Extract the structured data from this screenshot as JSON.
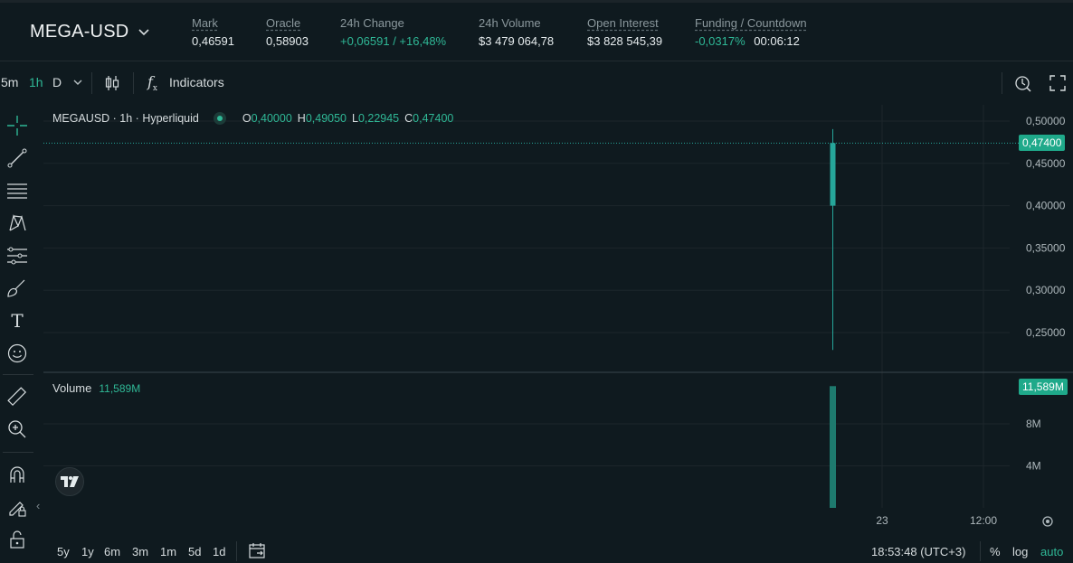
{
  "market": {
    "symbol": "MEGA-USD",
    "stats": [
      {
        "label": "Mark",
        "value": "0,46591"
      },
      {
        "label": "Oracle",
        "value": "0,58903"
      },
      {
        "label": "24h Change",
        "value": "+0,06591 / +16,48%"
      },
      {
        "label": "24h Volume",
        "value": "$3 479 064,78"
      },
      {
        "label": "Open Interest",
        "value": "$3 828 545,39"
      },
      {
        "label": "Funding / Countdown",
        "value_rate": "-0,0317%",
        "value_countdown": "00:06:12"
      }
    ]
  },
  "toolbar": {
    "intervals": [
      "5m",
      "1h",
      "D"
    ],
    "active_interval": "1h",
    "indicators_label": "Indicators"
  },
  "legend": {
    "title": "MEGAUSD · 1h · Hyperliquid",
    "open_key": "O",
    "open": "0,40000",
    "high_key": "H",
    "high": "0,49050",
    "low_key": "L",
    "low": "0,22945",
    "close_key": "C",
    "close": "0,47400"
  },
  "volume": {
    "label": "Volume",
    "value": "11,589M"
  },
  "price_tag": "0,47400",
  "volume_tag": "11,589M",
  "bottom": {
    "ranges": [
      "5y",
      "1y",
      "6m",
      "3m",
      "1m",
      "5d",
      "1d"
    ],
    "clock": "18:53:48 (UTC+3)",
    "percent": "%",
    "log": "log",
    "auto": "auto"
  },
  "colors": {
    "up": "#26a69a",
    "accent": "#2fb896",
    "background": "#0f1a1f",
    "grid": "#1c262b"
  },
  "chart_data": {
    "type": "candlestick",
    "price_axis": {
      "ticks": [
        "0,50000",
        "0,45000",
        "0,40000",
        "0,35000",
        "0,30000",
        "0,25000"
      ],
      "range": [
        0.2,
        0.5
      ]
    },
    "volume_axis": {
      "ticks": [
        "8M",
        "4M"
      ],
      "range": [
        0,
        12
      ]
    },
    "time_axis": {
      "ticks": [
        "23",
        "12:00"
      ]
    },
    "candles": [
      {
        "open": 0.4,
        "high": 0.4905,
        "low": 0.22945,
        "close": 0.474,
        "volume_m": 11.589
      }
    ],
    "grid": true
  }
}
